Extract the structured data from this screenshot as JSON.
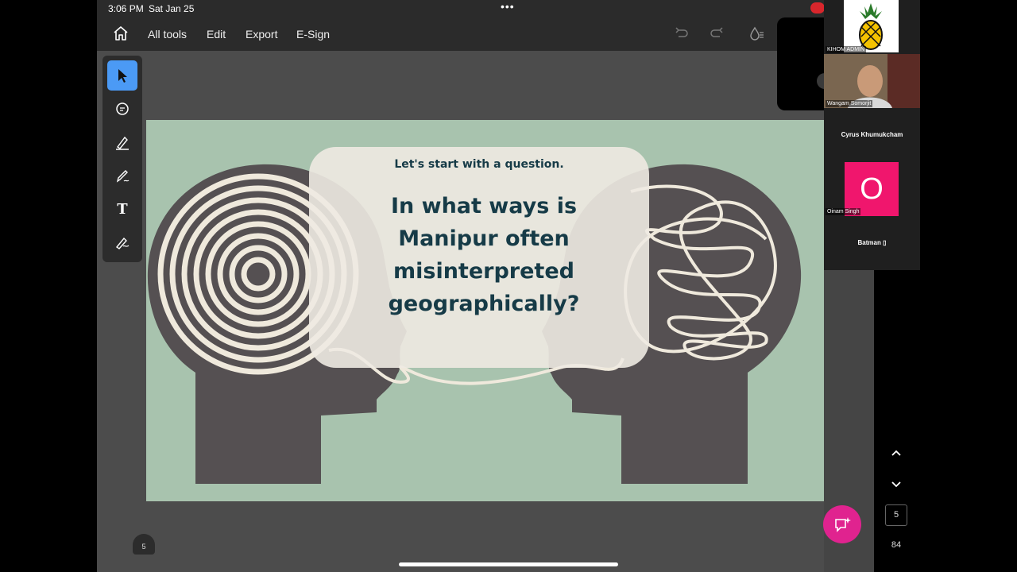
{
  "status_bar": {
    "time": "3:06 PM",
    "date": "Sat Jan 25",
    "dots": "•••"
  },
  "top_bar": {
    "menu": [
      "All tools",
      "Edit",
      "Export",
      "E-Sign"
    ]
  },
  "toolbar": {
    "tools": [
      {
        "icon": "select-arrow-icon",
        "active": true
      },
      {
        "icon": "comment-icon"
      },
      {
        "icon": "highlighter-icon"
      },
      {
        "icon": "draw-pencil-icon"
      },
      {
        "icon": "text-tool-icon",
        "glyph": "T"
      },
      {
        "icon": "sign-pen-icon"
      }
    ]
  },
  "slide": {
    "intro": "Let's start with a question.",
    "question": "In what ways is Manipur often misinterpreted geographically?",
    "colors": {
      "background": "#a8c3ae",
      "heads": "#555052",
      "lines": "#efe9dc",
      "text": "#163b47"
    }
  },
  "page_thumb": "5",
  "participants": {
    "logo_tag": "KIHOM ADMIN",
    "video_tag": "Wangam Somorjit",
    "name_1": "Cyrus Khumukcham",
    "avatar_letter": "O",
    "avatar_tag": "Oinam Singh",
    "name_2": "Batman ▯"
  },
  "navigation": {
    "current_page": "5",
    "total": "84"
  }
}
